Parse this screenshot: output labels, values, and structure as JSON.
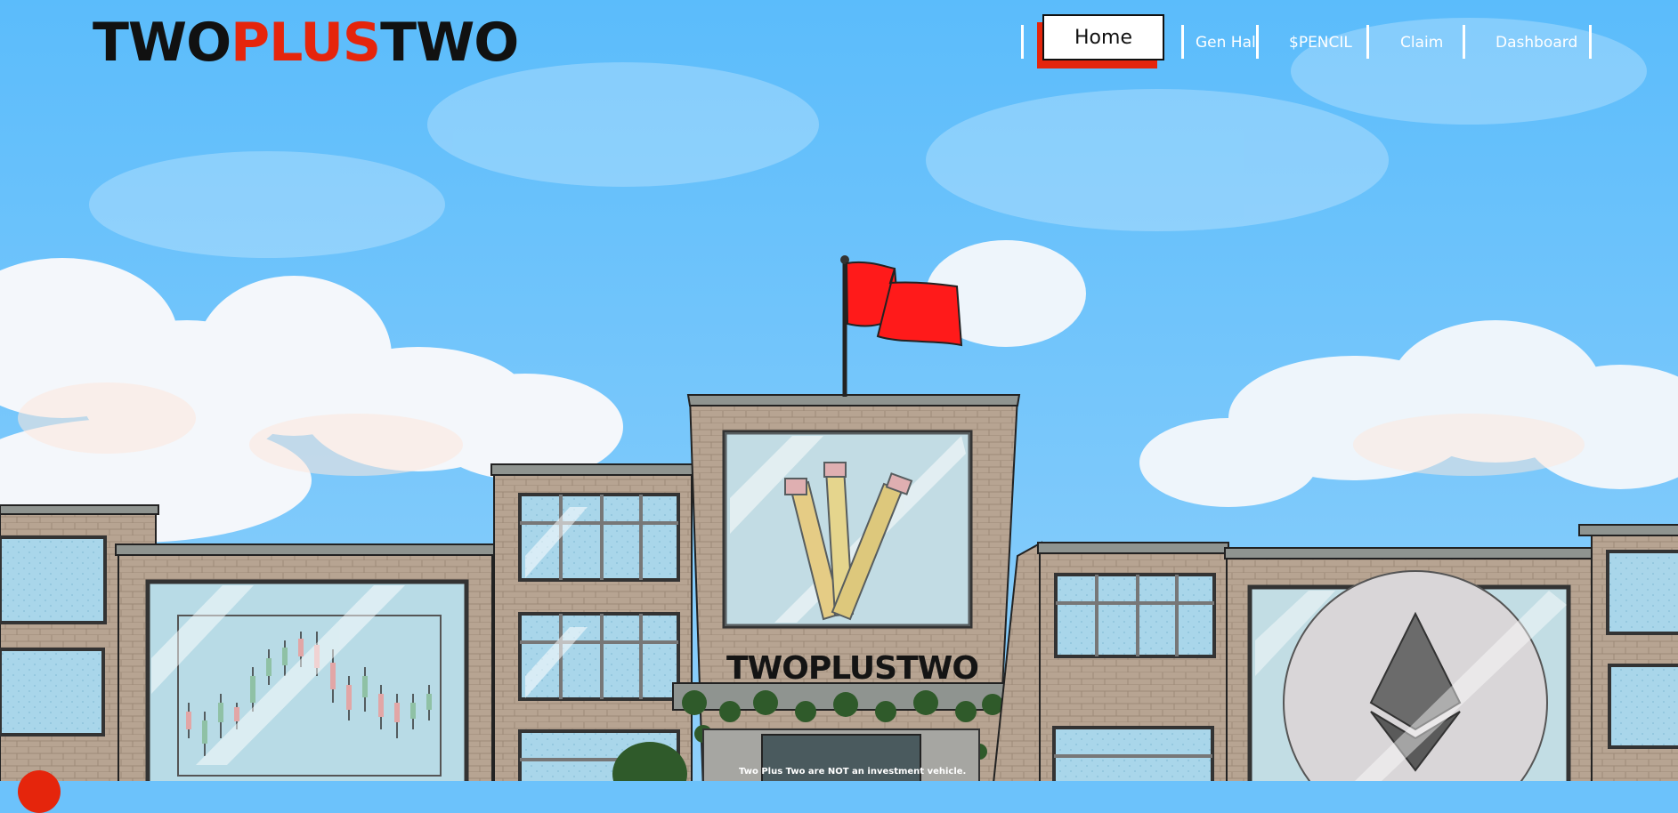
{
  "brand": {
    "logo_part1": "TWO",
    "logo_part2": "PLUS",
    "logo_part3": "TWO",
    "color_dark": "#111111",
    "color_accent": "#e5250c"
  },
  "nav": {
    "items": [
      {
        "label": "Home",
        "active": true
      },
      {
        "label": "Gen Hall"
      },
      {
        "label": "$PENCIL"
      },
      {
        "label": "Claim"
      },
      {
        "label": "Dashboard"
      }
    ]
  },
  "hero": {
    "building_sign": "TWOPLUSTWO",
    "disclaimer": "Two Plus Two are NOT an investment vehicle.",
    "flag_color": "#ff1a1a",
    "sky_color": "#6cc2fb"
  }
}
